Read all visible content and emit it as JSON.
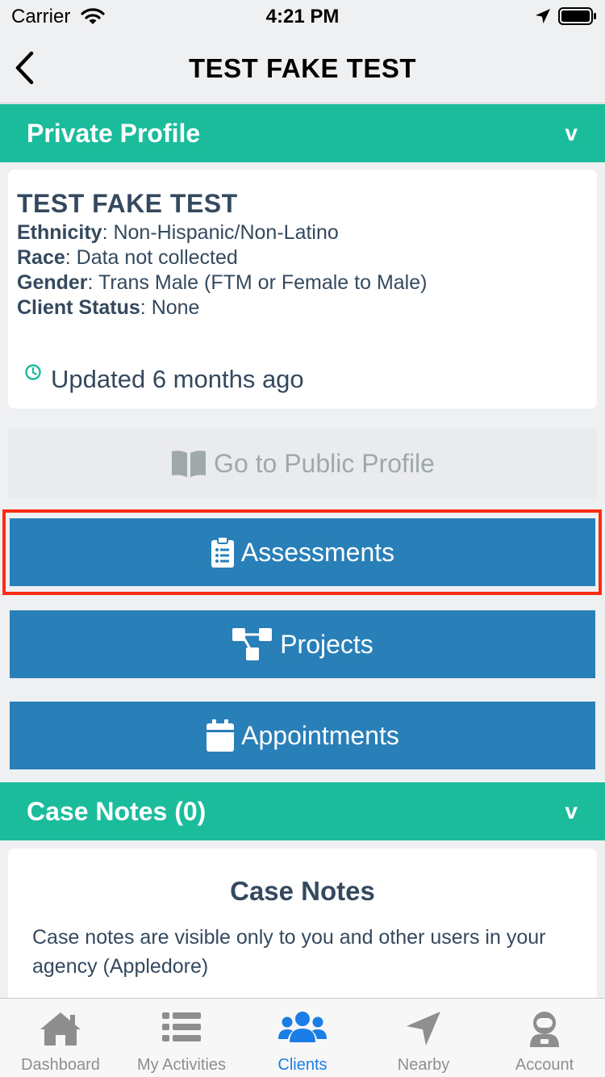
{
  "status_bar": {
    "carrier": "Carrier",
    "time": "4:21 PM"
  },
  "nav": {
    "title": "TEST FAKE TEST"
  },
  "private_profile": {
    "header": "Private Profile",
    "chevron": "v",
    "name": "TEST FAKE TEST",
    "fields": [
      {
        "label": "Ethnicity",
        "value": ": Non-Hispanic/Non-Latino"
      },
      {
        "label": "Race",
        "value": ": Data not collected"
      },
      {
        "label": "Gender",
        "value": ": Trans Male (FTM or Female to Male)"
      },
      {
        "label": "Client Status",
        "value": ": None"
      }
    ],
    "updated": "Updated 6 months ago"
  },
  "buttons": {
    "public_profile": "Go to Public Profile",
    "assessments": "Assessments",
    "projects": "Projects",
    "appointments": "Appointments"
  },
  "case_notes": {
    "header": "Case Notes (0)",
    "chevron": "v",
    "title": "Case Notes",
    "description": "Case notes are visible only to you and other users in your agency (Appledore)"
  },
  "tabs": [
    {
      "label": "Dashboard",
      "icon": "home-icon"
    },
    {
      "label": "My Activities",
      "icon": "list-icon"
    },
    {
      "label": "Clients",
      "icon": "users-icon",
      "active": true
    },
    {
      "label": "Nearby",
      "icon": "location-arrow-icon"
    },
    {
      "label": "Account",
      "icon": "astronaut-icon"
    }
  ],
  "colors": {
    "accent": "#1abc9c",
    "primary_button": "#2980b9",
    "text": "#34495e",
    "highlight": "#ff2a12",
    "active_tab": "#1b7ee6"
  }
}
